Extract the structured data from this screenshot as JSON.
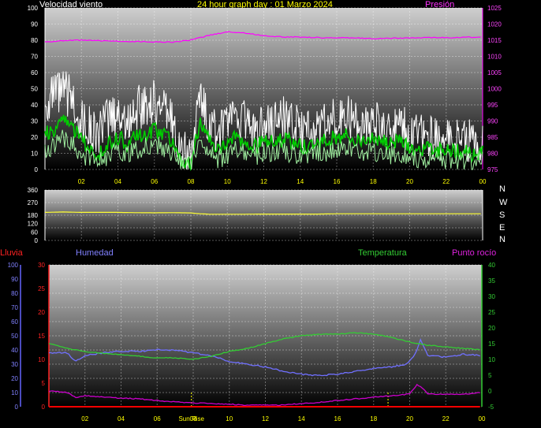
{
  "header": {
    "left": "Velocidad viento",
    "center": "24 hour graph day : 01 Marzo 2024",
    "right": "Presión"
  },
  "lower_header": {
    "rain": "Lluvia",
    "humidity": "Humedad",
    "temperature": "Temperatura",
    "dewpoint": "Punto rocío"
  },
  "compass": [
    "N",
    "W",
    "S",
    "E",
    "N"
  ],
  "markers": {
    "sunrise_label": "Sun Rise",
    "sunrise_hour": 7.9,
    "sunset_hour": 18.8
  },
  "colors": {
    "title_yellow": "#ffff00",
    "wind_gust": "#ffffff",
    "wind_avg": "#00cc00",
    "wind_speed": "#a0f0a0",
    "pressure": "#ff00ff",
    "direction": "#ffff33",
    "rain": "#ff0000",
    "humidity": "#7070ff",
    "temperature": "#33cc33",
    "dewpoint": "#cc00cc"
  },
  "chart_data": [
    {
      "type": "line",
      "title": "24 hour graph day : 01 Marzo 2024",
      "xlabel": "",
      "ylabel": "Velocidad viento",
      "y2label": "Presión",
      "x_ticks": [
        "02",
        "04",
        "06",
        "08",
        "10",
        "12",
        "14",
        "16",
        "18",
        "20",
        "22",
        "00"
      ],
      "x_tick_hours": [
        2,
        4,
        6,
        8,
        10,
        12,
        14,
        16,
        18,
        20,
        22,
        24
      ],
      "xlim": [
        0,
        24
      ],
      "ylim": [
        0,
        100
      ],
      "y_ticks": [
        0,
        10,
        20,
        30,
        40,
        50,
        60,
        70,
        80,
        90,
        100
      ],
      "y2lim": [
        975,
        1025
      ],
      "y2_ticks": [
        975,
        980,
        985,
        990,
        995,
        1000,
        1005,
        1010,
        1015,
        1020,
        1025
      ],
      "grid": true,
      "series": [
        {
          "name": "Velocidad viento",
          "role": "gust",
          "axis": "left",
          "x": [
            0,
            0.5,
            1,
            1.5,
            2,
            2.5,
            3,
            3.5,
            4,
            4.5,
            5,
            5.5,
            6,
            6.5,
            7,
            7.5,
            8,
            8.5,
            9,
            9.5,
            10,
            10.5,
            11,
            11.5,
            12,
            12.5,
            13,
            13.5,
            14,
            14.5,
            15,
            15.5,
            16,
            16.5,
            17,
            17.5,
            18,
            18.5,
            19,
            19.5,
            20,
            20.5,
            21,
            21.5,
            22,
            22.5,
            23,
            23.5,
            24
          ],
          "values": [
            40,
            45,
            48,
            44,
            30,
            25,
            22,
            32,
            35,
            28,
            38,
            40,
            42,
            36,
            30,
            10,
            8,
            45,
            30,
            20,
            28,
            35,
            30,
            22,
            28,
            30,
            32,
            28,
            25,
            22,
            28,
            30,
            32,
            34,
            30,
            28,
            30,
            28,
            26,
            28,
            22,
            20,
            22,
            18,
            20,
            18,
            20,
            16,
            20
          ]
        },
        {
          "name": "",
          "role": "average",
          "axis": "left",
          "x": [
            0,
            0.5,
            1,
            1.5,
            2,
            2.5,
            3,
            3.5,
            4,
            4.5,
            5,
            5.5,
            6,
            6.5,
            7,
            7.5,
            8,
            8.5,
            9,
            9.5,
            10,
            10.5,
            11,
            11.5,
            12,
            12.5,
            13,
            13.5,
            14,
            14.5,
            15,
            15.5,
            16,
            16.5,
            17,
            17.5,
            18,
            18.5,
            19,
            19.5,
            20,
            20.5,
            21,
            21.5,
            22,
            22.5,
            23,
            23.5,
            24
          ],
          "values": [
            22,
            25,
            30,
            26,
            18,
            12,
            10,
            16,
            20,
            16,
            20,
            22,
            24,
            22,
            18,
            6,
            5,
            28,
            18,
            12,
            16,
            20,
            18,
            14,
            17,
            18,
            19,
            17,
            15,
            13,
            16,
            18,
            20,
            21,
            19,
            17,
            19,
            17,
            16,
            17,
            13,
            12,
            13,
            11,
            12,
            11,
            12,
            9,
            11
          ]
        },
        {
          "name": "",
          "role": "speed",
          "axis": "left",
          "x": [
            0,
            0.5,
            1,
            1.5,
            2,
            2.5,
            3,
            3.5,
            4,
            4.5,
            5,
            5.5,
            6,
            6.5,
            7,
            7.5,
            8,
            8.5,
            9,
            9.5,
            10,
            10.5,
            11,
            11.5,
            12,
            12.5,
            13,
            13.5,
            14,
            14.5,
            15,
            15.5,
            16,
            16.5,
            17,
            17.5,
            18,
            18.5,
            19,
            19.5,
            20,
            20.5,
            21,
            21.5,
            22,
            22.5,
            23,
            23.5,
            24
          ],
          "values": [
            12,
            15,
            20,
            16,
            10,
            6,
            5,
            9,
            12,
            9,
            12,
            14,
            16,
            13,
            10,
            3,
            2,
            20,
            10,
            6,
            9,
            12,
            10,
            8,
            10,
            11,
            12,
            10,
            9,
            8,
            10,
            11,
            12,
            13,
            11,
            10,
            11,
            10,
            9,
            10,
            7,
            6,
            7,
            6,
            6,
            5,
            6,
            4,
            5
          ]
        },
        {
          "name": "Presión",
          "role": "pressure",
          "axis": "right",
          "x": [
            0,
            1,
            2,
            3,
            4,
            5,
            6,
            7,
            8,
            9,
            10,
            11,
            12,
            13,
            14,
            15,
            16,
            17,
            18,
            19,
            20,
            21,
            22,
            23,
            24
          ],
          "values": [
            1014.5,
            1014.8,
            1015,
            1014.8,
            1014.7,
            1014.6,
            1014.5,
            1014.4,
            1015,
            1016.5,
            1017.6,
            1017.2,
            1016.4,
            1016,
            1016,
            1015.8,
            1015.7,
            1015.7,
            1015.5,
            1015.6,
            1015.7,
            1015.8,
            1015.8,
            1015.9,
            1015.9
          ]
        }
      ]
    },
    {
      "type": "line",
      "title": "",
      "xlabel": "",
      "ylabel": "",
      "ylim": [
        0,
        360
      ],
      "y_ticks": [
        0,
        90,
        180,
        270,
        360
      ],
      "y_ticks_left": [
        0,
        60,
        120,
        180,
        270,
        360
      ],
      "xlim": [
        0,
        24
      ],
      "grid": true,
      "series": [
        {
          "name": "",
          "role": "direction",
          "x": [
            0,
            1,
            2,
            3,
            4,
            5,
            6,
            7,
            8,
            8.5,
            9,
            10,
            11,
            12,
            13,
            14,
            15,
            16,
            17,
            18,
            19,
            20,
            21,
            22,
            23,
            24
          ],
          "values": [
            200,
            203,
            200,
            200,
            200,
            198,
            197,
            198,
            196,
            190,
            187,
            187,
            187,
            188,
            188,
            188,
            188,
            190,
            190,
            190,
            190,
            190,
            190,
            190,
            190,
            190
          ]
        }
      ]
    },
    {
      "type": "line",
      "title": "",
      "xlabel": "",
      "ylabel": "Humedad",
      "xlim": [
        0,
        24
      ],
      "x_ticks": [
        "02",
        "04",
        "06",
        "08",
        "10",
        "12",
        "14",
        "16",
        "18",
        "20",
        "22",
        "00"
      ],
      "x_tick_hours": [
        2,
        4,
        6,
        8,
        10,
        12,
        14,
        16,
        18,
        20,
        22,
        24
      ],
      "ylim_humidity": [
        0,
        100
      ],
      "y_ticks_humidity": [
        0,
        10,
        20,
        30,
        40,
        50,
        60,
        70,
        80,
        90,
        100
      ],
      "ylim_rain": [
        0,
        30
      ],
      "y_ticks_rain": [
        0,
        5,
        10,
        15,
        20,
        25,
        30
      ],
      "ylim_temp": [
        -5,
        40
      ],
      "y_ticks_temp": [
        -5,
        0,
        5,
        10,
        15,
        20,
        25,
        30,
        35,
        40
      ],
      "grid": true,
      "series": [
        {
          "name": "Lluvia",
          "role": "rain",
          "axis": "rain",
          "x": [
            0,
            24
          ],
          "values": [
            0,
            0
          ]
        },
        {
          "name": "Humedad",
          "role": "humidity",
          "axis": "humidity",
          "x": [
            0,
            1,
            1.5,
            2,
            3,
            4,
            5,
            6,
            7,
            8,
            9,
            10,
            11,
            12,
            13,
            14,
            15,
            16,
            17,
            18,
            19,
            19.8,
            20.3,
            20.6,
            21,
            22,
            23,
            24
          ],
          "values": [
            38,
            38,
            32,
            36,
            38,
            39,
            39,
            40,
            40,
            38,
            36,
            32,
            30,
            28,
            25,
            23,
            22,
            23,
            25,
            27,
            28,
            30,
            37,
            47,
            36,
            35,
            37,
            36
          ]
        },
        {
          "name": "Temperatura",
          "role": "temperature",
          "axis": "temp",
          "x": [
            0,
            1,
            2,
            3,
            4,
            5,
            6,
            7,
            8,
            9,
            10,
            11,
            12,
            13,
            14,
            15,
            16,
            17,
            18,
            19,
            20,
            21,
            22,
            23,
            24
          ],
          "values": [
            15,
            13.5,
            12.5,
            12,
            11.5,
            11,
            10.5,
            10.5,
            10,
            11,
            12.5,
            13.5,
            15,
            16.5,
            17.5,
            18,
            18,
            18.5,
            18,
            17,
            15.5,
            14.5,
            14,
            13.5,
            13
          ]
        },
        {
          "name": "Punto rocío",
          "role": "dewpoint",
          "axis": "temp",
          "x": [
            0,
            0.5,
            1,
            1.5,
            2,
            3,
            4,
            5,
            6,
            7,
            8,
            9,
            10,
            11,
            12,
            13,
            14,
            15,
            16,
            17,
            18,
            19,
            20,
            20.4,
            20.7,
            21,
            22,
            23,
            24
          ],
          "values": [
            0,
            -0.2,
            -0.5,
            -2,
            -1.5,
            -2,
            -2.3,
            -2.5,
            -3,
            -3.5,
            -3.8,
            -4,
            -4.2,
            -4.5,
            -4.5,
            -4.5,
            -4,
            -3.6,
            -3,
            -2.5,
            -2,
            -1.5,
            -1,
            2,
            1,
            -1,
            -1,
            -1,
            -0.5
          ]
        }
      ]
    }
  ]
}
